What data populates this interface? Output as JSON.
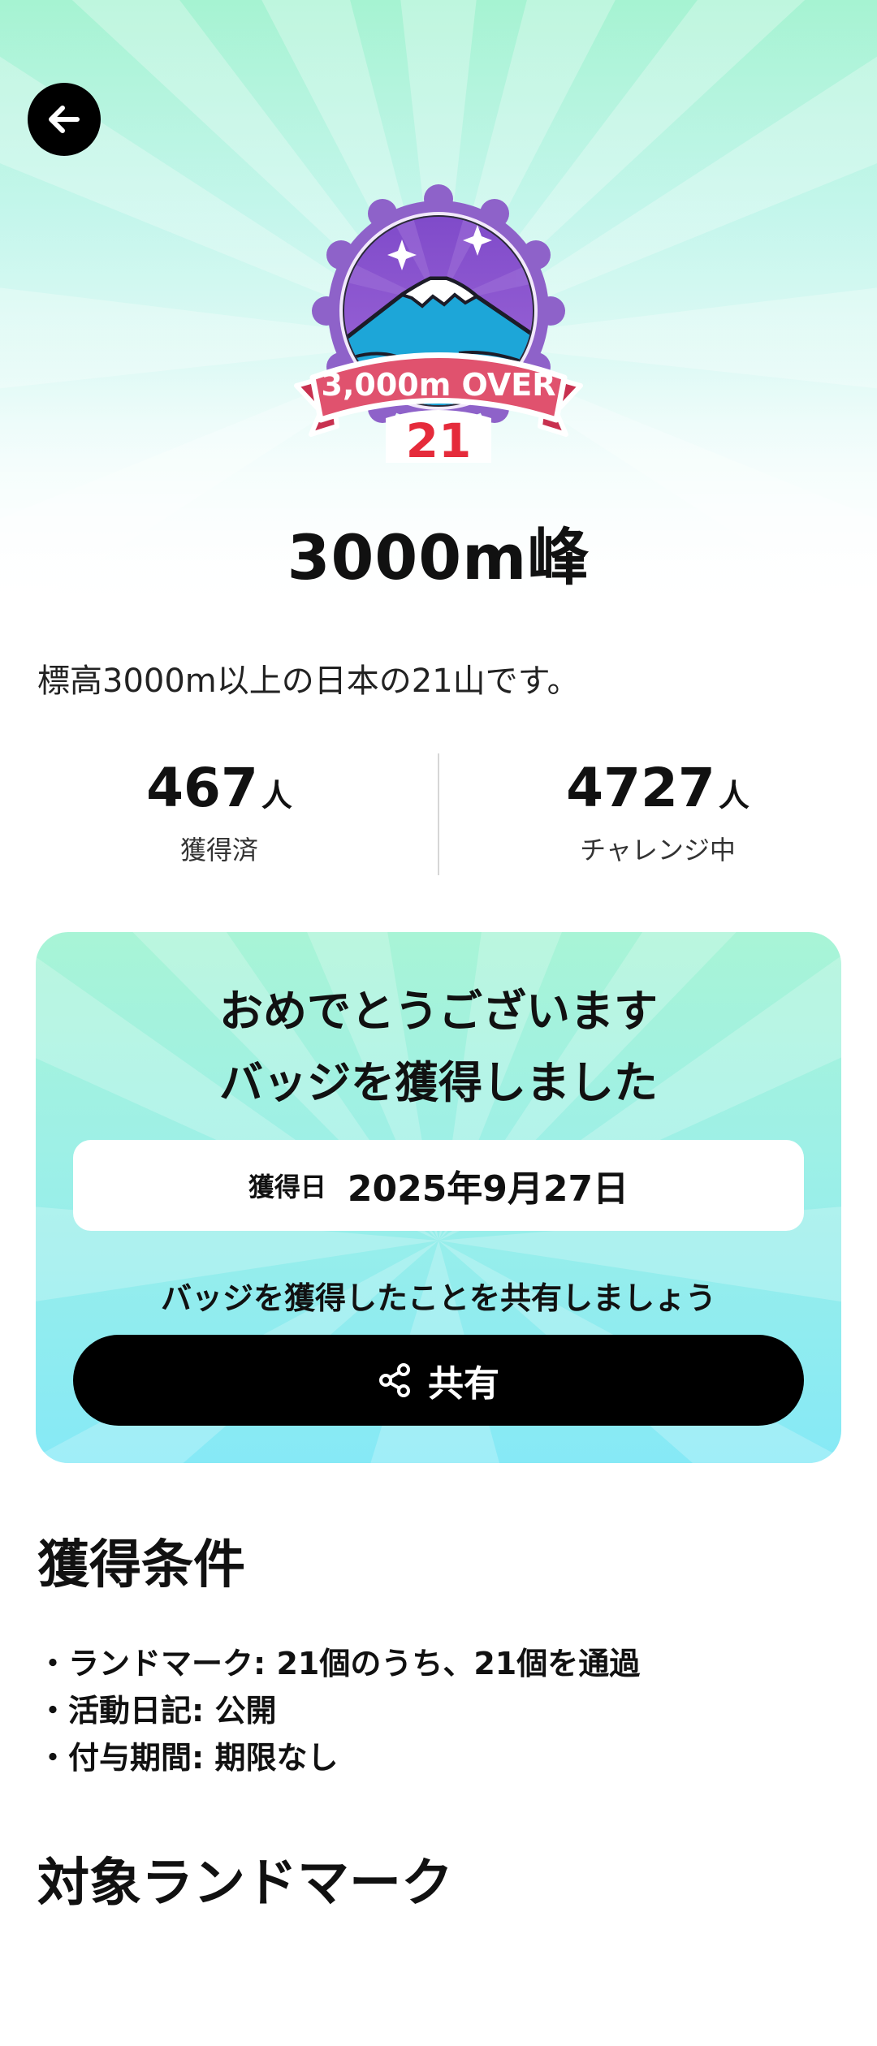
{
  "badge": {
    "banner_text": "3,000m OVER",
    "number": "21",
    "colors": {
      "banner": "#e0526e",
      "number": "#e52b3b",
      "ring": "#8e62c9",
      "sky": "#7e49c9",
      "mountain": "#1da6d8"
    }
  },
  "title": "3000m峰",
  "description": "標高3000m以上の日本の21山です。",
  "stats": [
    {
      "value": "467",
      "unit": "人",
      "label": "獲得済"
    },
    {
      "value": "4727",
      "unit": "人",
      "label": "チャレンジ中"
    }
  ],
  "congrats": {
    "line1": "おめでとうございます",
    "line2": "バッジを獲得しました",
    "date_label": "獲得日",
    "date_value": "2025年9月27日",
    "share_prompt": "バッジを獲得したことを共有しましょう",
    "share_button": "共有",
    "share_icon": "share-icon"
  },
  "conditions": {
    "heading": "獲得条件",
    "items": [
      "ランドマーク: 21個のうち、21個を通過",
      "活動日記: 公開",
      "付与期間: 期限なし"
    ]
  },
  "landmarks_heading": "対象ランドマーク",
  "icons": {
    "back": "arrow-left-icon"
  }
}
